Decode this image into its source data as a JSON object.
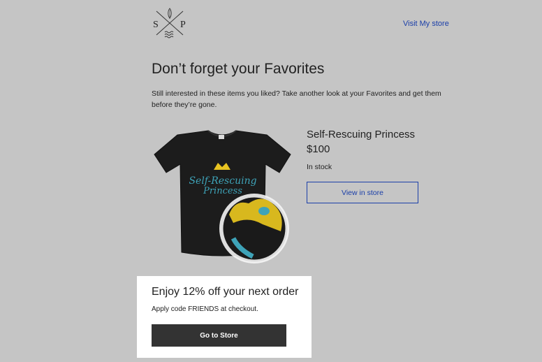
{
  "header": {
    "logo_letters": [
      "S",
      "P"
    ],
    "visit_store_label": "Visit My store"
  },
  "main": {
    "heading": "Don’t forget your Favorites",
    "intro": "Still interested in these items you liked? Take another look at your Favorites and get them before they’re gone."
  },
  "product": {
    "name": "Self-Rescuing Princess",
    "price": "$100",
    "stock_status": "In stock",
    "view_button_label": "View in store",
    "image_icon": "tshirt-image",
    "image_text": [
      "Self-Rescuing",
      "Princess"
    ]
  },
  "promo": {
    "title": "Enjoy 12% off your next order",
    "text": "Apply code FRIENDS at checkout.",
    "button_label": "Go to Store"
  },
  "colors": {
    "background": "#c5c5c5",
    "link": "#1a3ea8",
    "button_dark": "#333333",
    "crown_yellow": "#e8c321",
    "print_blue": "#3ea3b8"
  }
}
